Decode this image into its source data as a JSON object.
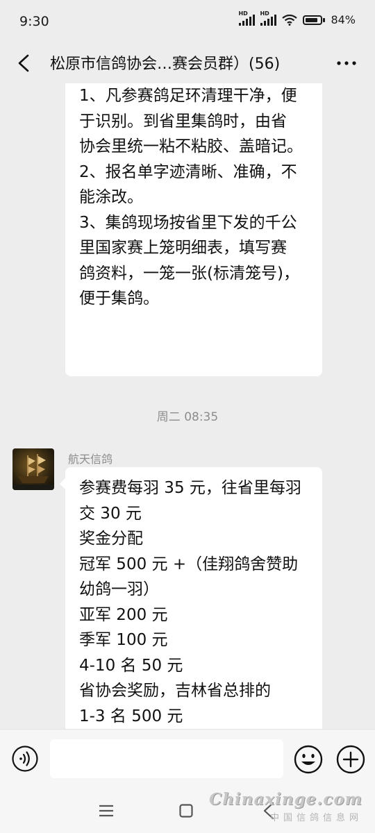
{
  "status_bar": {
    "time": "9:30",
    "signal_1_label": "HD",
    "signal_2_label": "HD",
    "battery_percent": "84%",
    "battery_level": 0.84,
    "icons": [
      "signal-icon",
      "signal-icon",
      "wifi-icon",
      "battery-icon"
    ]
  },
  "header": {
    "title": "松原市信鸽协会…赛会员群）(56)",
    "back_icon": "chevron-left-icon",
    "more_icon": "more-dots-icon"
  },
  "messages": [
    {
      "lines": [
        "1、凡参赛鸽足环清理干净，便",
        "于识别。到省里集鸽时，由省",
        "协会里统一粘不粘胶、盖暗记。",
        "2、报名单字迹清晰、准确，不",
        "能涂改。",
        "3、集鸽现场按省里下发的千公",
        "里国家赛上笼明细表，填写赛",
        "鸽资料，一笼一张(标清笼号)，",
        "便于集鸽。"
      ]
    }
  ],
  "timestamp": "周二 08:35",
  "incoming_message": {
    "sender": "航天信鸽",
    "avatar_icon": "ship-avatar-icon",
    "lines": [
      "参赛费每羽 35 元，往省里每羽",
      "交 30 元",
      "奖金分配",
      "冠军 500 元 +（佳翔鸽舍赞助",
      "幼鸽一羽）",
      "亚军 200 元",
      "季军 100 元",
      "4-10 名 50 元",
      "省协会奖励，吉林省总排的",
      "1-3 名 500 元"
    ]
  },
  "input_bar": {
    "placeholder": "",
    "value": "",
    "icons": [
      "voice-icon",
      "emoji-icon",
      "plus-icon"
    ]
  },
  "nav_bar": {
    "icons": [
      "menu-icon",
      "home-icon",
      "back-icon"
    ]
  },
  "watermark": {
    "main": "Chinaxinge.com",
    "sub": "中国信鸽信息网"
  },
  "colors": {
    "background": "#ededed",
    "bubble": "#ffffff",
    "muted_text": "#8c8c8c",
    "input_bar": "#f6f6f6"
  }
}
